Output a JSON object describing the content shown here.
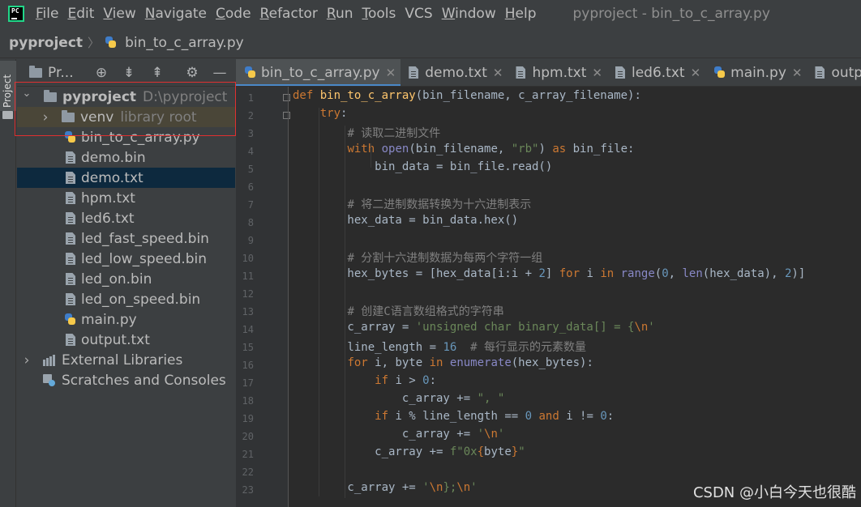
{
  "menubar": {
    "app_icon": "pycharm-logo-icon",
    "items": [
      {
        "u": "F",
        "rest": "ile"
      },
      {
        "u": "E",
        "rest": "dit"
      },
      {
        "u": "V",
        "rest": "iew"
      },
      {
        "u": "N",
        "rest": "avigate"
      },
      {
        "u": "C",
        "rest": "ode"
      },
      {
        "u": "R",
        "rest": "efactor"
      },
      {
        "u": "R",
        "rest": "un"
      },
      {
        "u": "T",
        "rest": "ools"
      },
      {
        "u": "",
        "rest": "VCS"
      },
      {
        "u": "W",
        "rest": "indow"
      },
      {
        "u": "H",
        "rest": "elp"
      }
    ],
    "title": "pyproject - bin_to_c_array.py"
  },
  "navbar": {
    "project": "pyproject",
    "separator": "〉",
    "file": "bin_to_c_array.py"
  },
  "toolstrip": {
    "tab_label": "Project"
  },
  "project_panel": {
    "title": "Pr...",
    "header_buttons": [
      "crosshair-icon",
      "collapse-all-icon",
      "expand-all-icon",
      "gear-icon",
      "hide-icon"
    ],
    "root": {
      "name": "pyproject",
      "path": "D:\\pyproject"
    },
    "venv": {
      "name": "venv",
      "hint": "library root"
    },
    "files": [
      {
        "name": "bin_to_c_array.py",
        "icon": "python-file-icon"
      },
      {
        "name": "demo.bin",
        "icon": "file-icon"
      },
      {
        "name": "demo.txt",
        "icon": "file-icon",
        "selected": true
      },
      {
        "name": "hpm.txt",
        "icon": "file-icon"
      },
      {
        "name": "led6.txt",
        "icon": "file-icon"
      },
      {
        "name": "led_fast_speed.bin",
        "icon": "file-icon"
      },
      {
        "name": "led_low_speed.bin",
        "icon": "file-icon"
      },
      {
        "name": "led_on.bin",
        "icon": "file-icon"
      },
      {
        "name": "led_on_speed.bin",
        "icon": "file-icon"
      },
      {
        "name": "main.py",
        "icon": "python-file-icon"
      },
      {
        "name": "output.txt",
        "icon": "file-icon"
      }
    ],
    "external_libraries": "External Libraries",
    "scratches": "Scratches and Consoles"
  },
  "tabs": [
    {
      "label": "bin_to_c_array.py",
      "icon": "python-file-icon",
      "active": true
    },
    {
      "label": "demo.txt",
      "icon": "file-icon"
    },
    {
      "label": "hpm.txt",
      "icon": "file-icon"
    },
    {
      "label": "led6.txt",
      "icon": "file-icon"
    },
    {
      "label": "main.py",
      "icon": "python-file-icon"
    },
    {
      "label": "output.txt",
      "icon": "file-icon"
    }
  ],
  "colors": {
    "keyword": "#cc7832",
    "function": "#ffc66d",
    "string": "#6a8759",
    "number": "#6897bb",
    "comment": "#808080",
    "builtin": "#8888c6",
    "default": "#a9b7c6",
    "selection": "#0d293e",
    "highlight_box": "#e03030"
  },
  "code": [
    [
      [
        "kw",
        "def "
      ],
      [
        "fn",
        "bin_to_c_array"
      ],
      [
        "",
        "(bin_filename, c_array_filename):"
      ]
    ],
    [
      [
        "",
        "    "
      ],
      [
        "kw",
        "try"
      ],
      [
        "",
        ":"
      ]
    ],
    [
      [
        "",
        "        "
      ],
      [
        "cmt",
        "# 读取二进制文件"
      ]
    ],
    [
      [
        "",
        "        "
      ],
      [
        "kw",
        "with "
      ],
      [
        "bi",
        "open"
      ],
      [
        "",
        "(bin_filename, "
      ],
      [
        "str",
        "\"rb\""
      ],
      [
        "",
        ") "
      ],
      [
        "kw",
        "as "
      ],
      [
        "",
        "bin_file:"
      ]
    ],
    [
      [
        "",
        "            bin_data = bin_file.read()"
      ]
    ],
    [],
    [
      [
        "",
        "        "
      ],
      [
        "cmt",
        "# 将二进制数据转换为十六进制表示"
      ]
    ],
    [
      [
        "",
        "        hex_data = bin_data.hex()"
      ]
    ],
    [],
    [
      [
        "",
        "        "
      ],
      [
        "cmt",
        "# 分割十六进制数据为每两个字符一组"
      ]
    ],
    [
      [
        "",
        "        hex_bytes = [hex_data[i:i + "
      ],
      [
        "num",
        "2"
      ],
      [
        "",
        "] "
      ],
      [
        "kw",
        "for "
      ],
      [
        "",
        "i "
      ],
      [
        "kw",
        "in "
      ],
      [
        "bi",
        "range"
      ],
      [
        "",
        "("
      ],
      [
        "num",
        "0"
      ],
      [
        "",
        ", "
      ],
      [
        "bi",
        "len"
      ],
      [
        "",
        "(hex_data), "
      ],
      [
        "num",
        "2"
      ],
      [
        "",
        ")]"
      ]
    ],
    [],
    [
      [
        "",
        "        "
      ],
      [
        "cmt",
        "# 创建C语言数组格式的字符串"
      ]
    ],
    [
      [
        "",
        "        c_array = "
      ],
      [
        "str",
        "'unsigned char binary_data[] = {"
      ],
      [
        "kw",
        "\\n"
      ],
      [
        "str",
        "'"
      ]
    ],
    [
      [
        "",
        "        line_length = "
      ],
      [
        "num",
        "16  "
      ],
      [
        "cmt",
        "# 每行显示的元素数量"
      ]
    ],
    [
      [
        "",
        "        "
      ],
      [
        "kw",
        "for "
      ],
      [
        "",
        "i, byte "
      ],
      [
        "kw",
        "in "
      ],
      [
        "bi",
        "enumerate"
      ],
      [
        "",
        "(hex_bytes):"
      ]
    ],
    [
      [
        "",
        "            "
      ],
      [
        "kw",
        "if "
      ],
      [
        "",
        "i > "
      ],
      [
        "num",
        "0"
      ],
      [
        "",
        ":"
      ]
    ],
    [
      [
        "",
        "                c_array += "
      ],
      [
        "str",
        "\", \""
      ]
    ],
    [
      [
        "",
        "            "
      ],
      [
        "kw",
        "if "
      ],
      [
        "",
        "i % line_length == "
      ],
      [
        "num",
        "0 "
      ],
      [
        "kw",
        "and "
      ],
      [
        "",
        "i != "
      ],
      [
        "num",
        "0"
      ],
      [
        "",
        ":"
      ]
    ],
    [
      [
        "",
        "                c_array += "
      ],
      [
        "str",
        "'"
      ],
      [
        "kw",
        "\\n"
      ],
      [
        "str",
        "'"
      ]
    ],
    [
      [
        "",
        "            c_array += "
      ],
      [
        "str",
        "f\"0x"
      ],
      [
        "kw",
        "{"
      ],
      [
        "fs",
        "byte"
      ],
      [
        "kw",
        "}"
      ],
      [
        "str",
        "\""
      ]
    ],
    [],
    [
      [
        "",
        "        c_array += "
      ],
      [
        "str",
        "'"
      ],
      [
        "kw",
        "\\n"
      ],
      [
        "str",
        "};"
      ],
      [
        "kw",
        "\\n"
      ],
      [
        "str",
        "'"
      ]
    ]
  ],
  "watermark": "CSDN @小白今天也很酷"
}
